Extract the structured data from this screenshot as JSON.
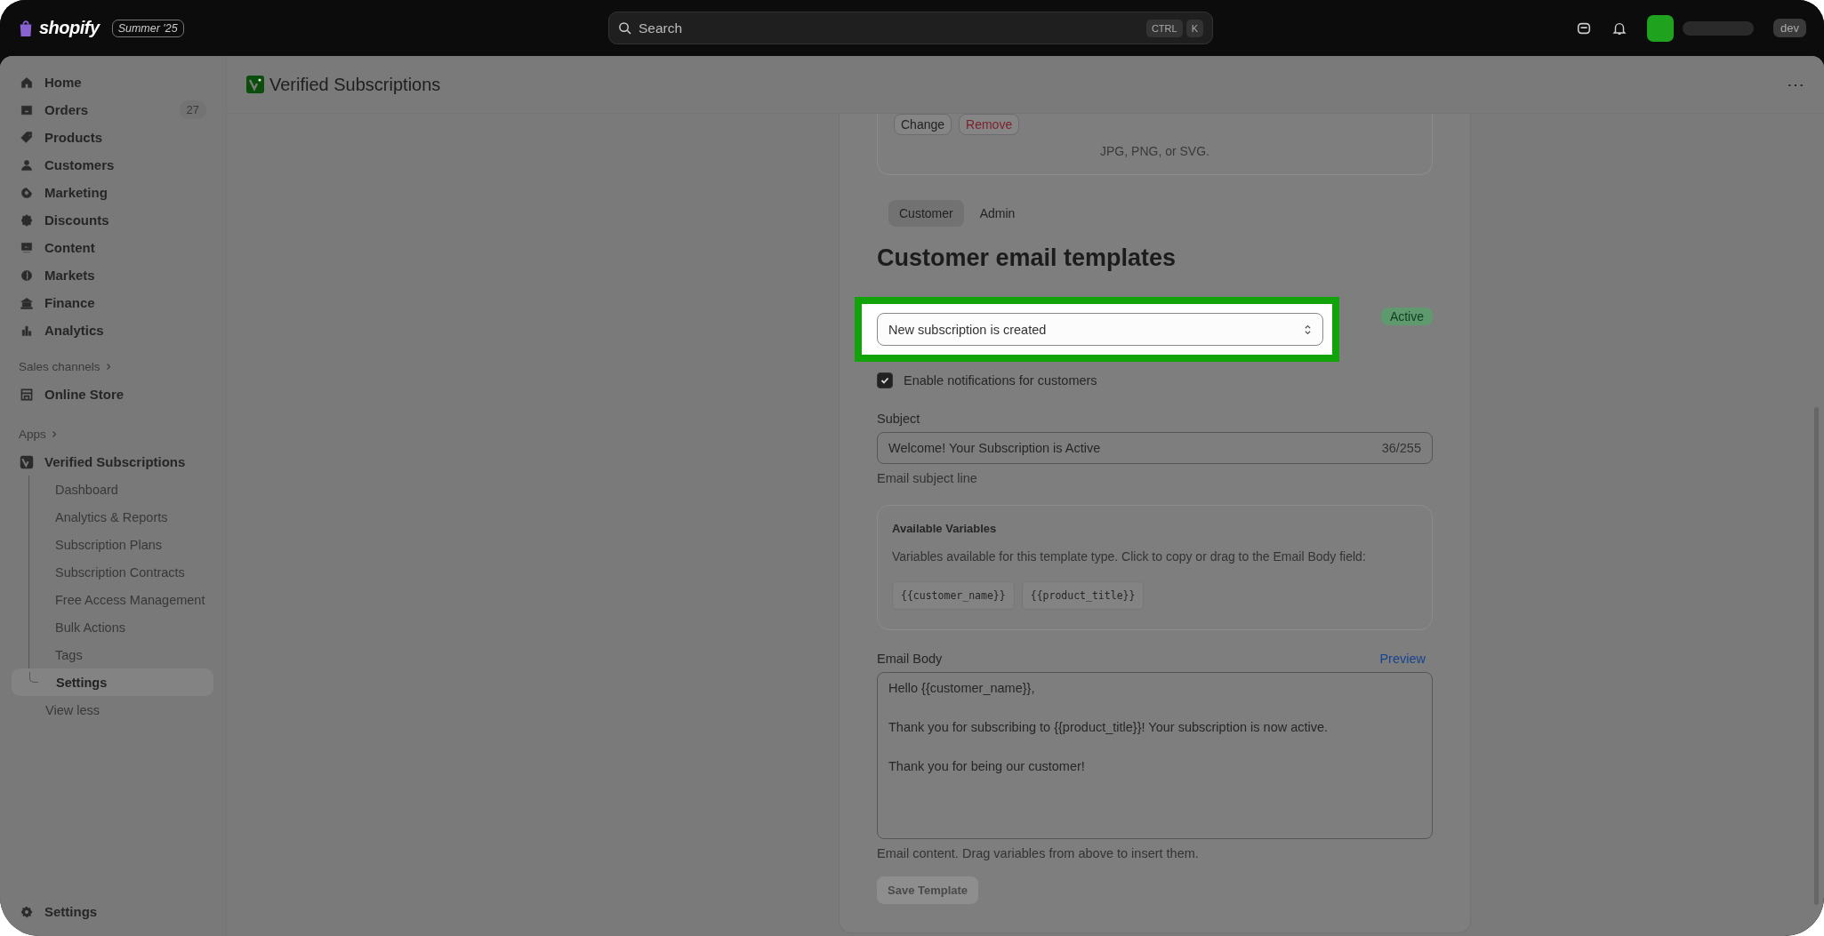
{
  "topbar": {
    "logo_text": "shopify",
    "edition_badge": "Summer '25",
    "search": {
      "placeholder": "Search",
      "keys": [
        "CTRL",
        "K"
      ]
    },
    "store_badge": "dev"
  },
  "sidebar": {
    "items": [
      {
        "label": "Home"
      },
      {
        "label": "Orders",
        "count": "27"
      },
      {
        "label": "Products"
      },
      {
        "label": "Customers"
      },
      {
        "label": "Marketing"
      },
      {
        "label": "Discounts"
      },
      {
        "label": "Content"
      },
      {
        "label": "Markets"
      },
      {
        "label": "Finance"
      },
      {
        "label": "Analytics"
      }
    ],
    "sales_channels": {
      "heading": "Sales channels",
      "items": [
        {
          "label": "Online Store"
        }
      ]
    },
    "apps": {
      "heading": "Apps",
      "app": {
        "label": "Verified Subscriptions",
        "children": [
          {
            "label": "Dashboard",
            "selected": false
          },
          {
            "label": "Analytics & Reports",
            "selected": false
          },
          {
            "label": "Subscription Plans",
            "selected": false
          },
          {
            "label": "Subscription Contracts",
            "selected": false
          },
          {
            "label": "Free Access Management",
            "selected": false
          },
          {
            "label": "Bulk Actions",
            "selected": false
          },
          {
            "label": "Tags",
            "selected": false
          },
          {
            "label": "Settings",
            "selected": true
          }
        ]
      },
      "toggle": "View less"
    },
    "footer": {
      "label": "Settings"
    }
  },
  "page": {
    "title": "Verified Subscriptions",
    "more": "⋯"
  },
  "logo_upload": {
    "buttons": [
      {
        "label": "Change",
        "kind": "default"
      },
      {
        "label": "Remove",
        "kind": "critical"
      }
    ],
    "hint": "JPG, PNG, or SVG."
  },
  "tabs": [
    {
      "label": "Customer",
      "selected": true
    },
    {
      "label": "Admin",
      "selected": false
    }
  ],
  "heading": "Customer email templates",
  "template_select": {
    "value": "New subscription is created",
    "highlighted": true
  },
  "status_badge": "Active",
  "notifications": {
    "label": "Enable notifications for customers",
    "checked": true
  },
  "subject": {
    "label": "Subject",
    "value": "Welcome! Your Subscription is Active",
    "counter": "36/255",
    "help": "Email subject line"
  },
  "variables": {
    "title": "Available Variables",
    "description": "Variables available for this template type. Click to copy or drag to the Email Body field:",
    "chips": [
      "{{customer_name}}",
      "{{product_title}}"
    ]
  },
  "email_body": {
    "label": "Email Body",
    "preview_link": "Preview",
    "lines": [
      "Hello {{customer_name}},",
      "Thank you for subscribing to {{product_title}}! Your subscription is now active.",
      "Thank you for being our customer!"
    ],
    "help": "Email content. Drag variables from above to insert them."
  },
  "save_button": {
    "label": "Save Template",
    "disabled": true
  }
}
